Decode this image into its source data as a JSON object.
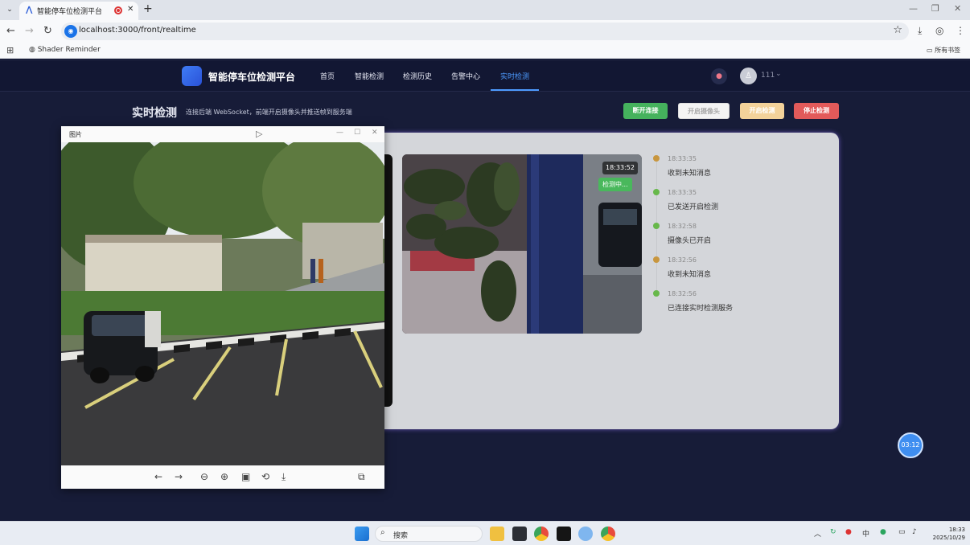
{
  "browser": {
    "tab_title": "智能停车位检测平台",
    "url": "localhost:3000/front/realtime",
    "bookmark": "Shader Reminder",
    "all_bookmarks": "所有书签"
  },
  "app": {
    "brand": "智能停车位检测平台",
    "nav": [
      "首页",
      "智能检测",
      "检测历史",
      "告警中心",
      "实时检测"
    ],
    "user_name": "111"
  },
  "page": {
    "title": "实时检测",
    "subtitle": "连接后端 WebSocket，前端开启摄像头并推送帧到服务端"
  },
  "actions": {
    "disconnect": "断开连接",
    "open_camera": "开启摄像头",
    "start_detect": "开启检测",
    "stop_detect": "停止检测"
  },
  "video": {
    "timestamp": "18:33:52",
    "status": "检测中..."
  },
  "timeline": [
    {
      "time": "18:33:35",
      "message": "收到未知消息",
      "color": "#c8963e"
    },
    {
      "time": "18:33:35",
      "message": "已发送开启检测",
      "color": "#67b84a"
    },
    {
      "time": "18:32:58",
      "message": "摄像头已开启",
      "color": "#67b84a"
    },
    {
      "time": "18:32:56",
      "message": "收到未知消息",
      "color": "#c8963e"
    },
    {
      "time": "18:32:56",
      "message": "已连接实时检测服务",
      "color": "#67b84a"
    }
  ],
  "float_timer": "03:12",
  "viewer": {
    "title": "图片"
  },
  "taskbar": {
    "search_placeholder": "搜索",
    "ime": "中",
    "time": "18:33",
    "date": "2025/10/29"
  }
}
